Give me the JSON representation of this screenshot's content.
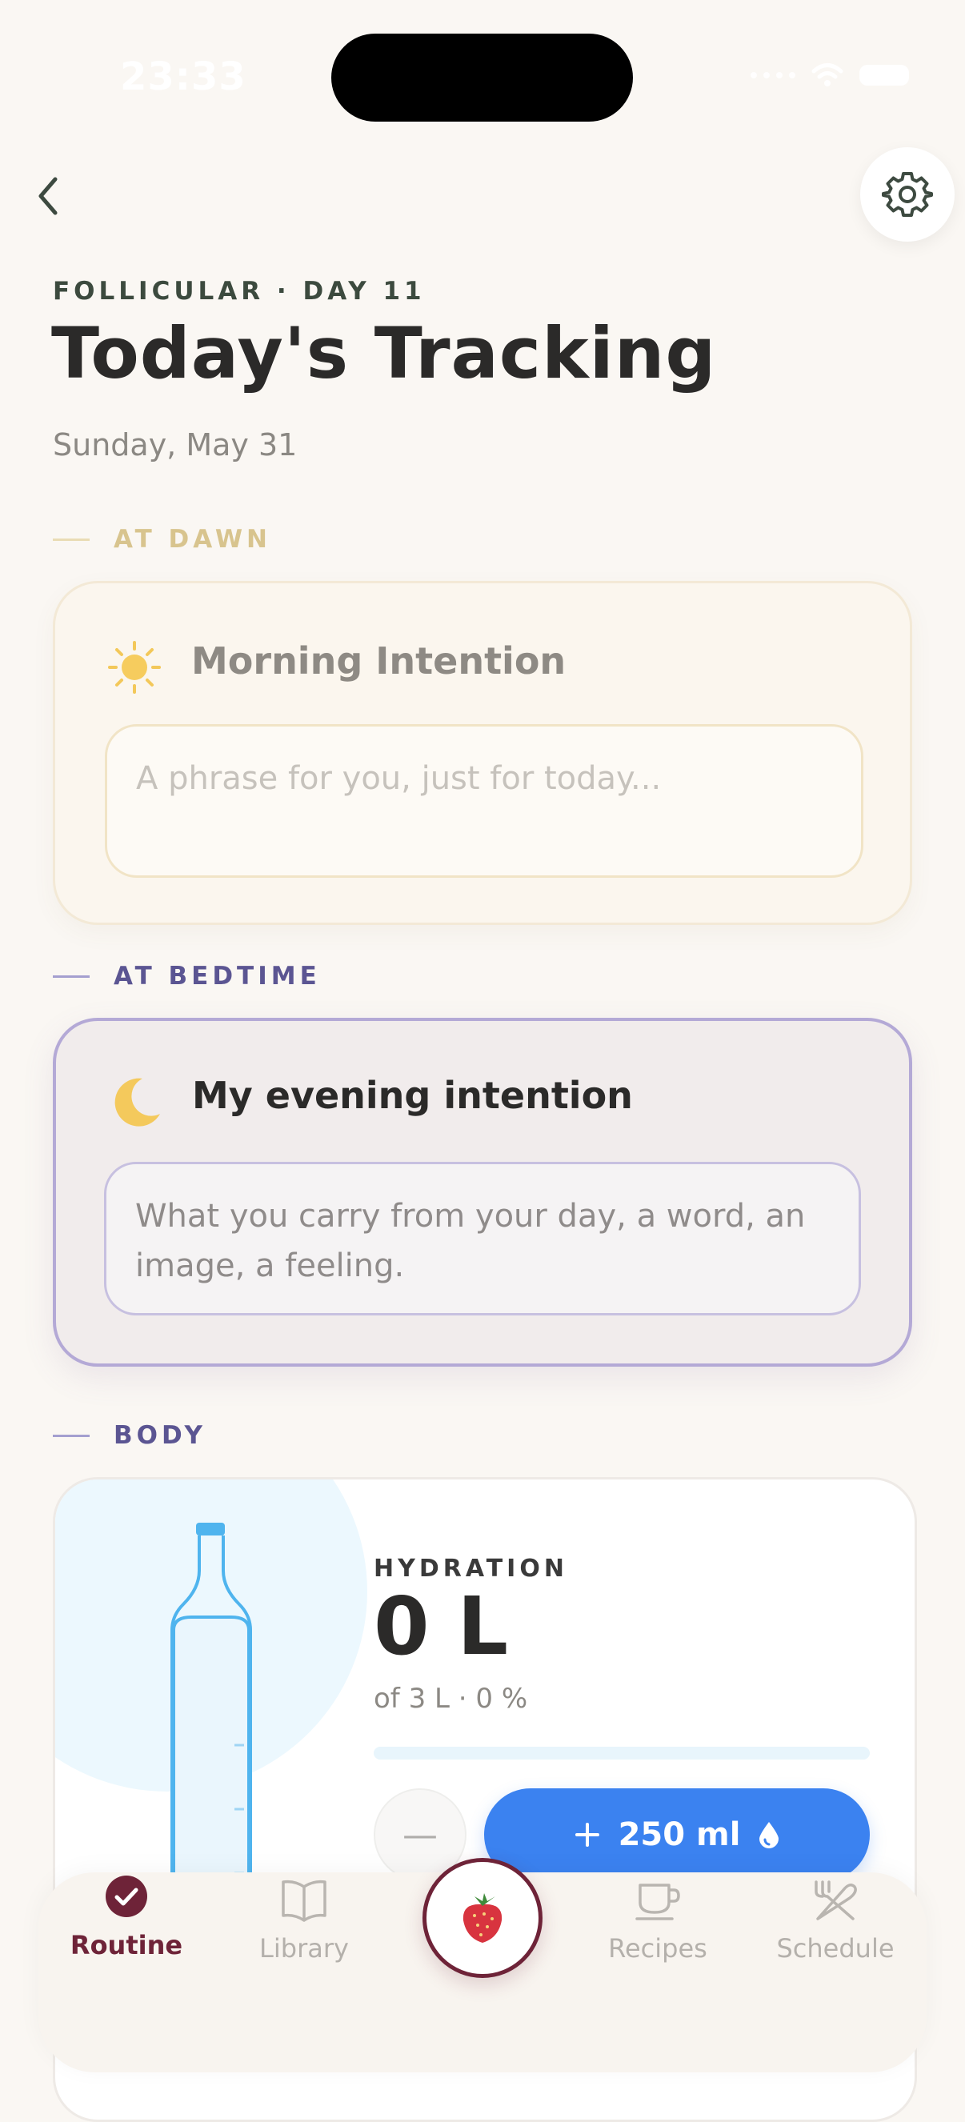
{
  "status_bar": {
    "time": "23:33"
  },
  "header": {
    "phase": "FOLLICULAR · DAY 11",
    "title": "Today's Tracking",
    "date": "Sunday, May 31"
  },
  "sections": {
    "dawn": "AT DAWN",
    "bedtime": "AT BEDTIME",
    "body": "BODY"
  },
  "morning_card": {
    "icon": "sun-icon",
    "title": "Morning Intention",
    "placeholder": "A phrase for you, just for today..."
  },
  "evening_card": {
    "icon": "moon-icon",
    "title": "My evening intention",
    "placeholder": "What you carry from your day, a word, an image, a feeling."
  },
  "hydration": {
    "label": "HYDRATION",
    "value": "0 L",
    "goal": "of 3 L · 0 %",
    "progress": 0,
    "add_label": "250 ml"
  },
  "nav": {
    "items": [
      {
        "label": "Routine",
        "icon": "check-circle-icon",
        "active": true
      },
      {
        "label": "Library",
        "icon": "book-icon",
        "active": false
      },
      {
        "label": "",
        "icon": "strawberry-icon",
        "active": false
      },
      {
        "label": "Recipes",
        "icon": "cup-icon",
        "active": false
      },
      {
        "label": "Schedule",
        "icon": "utensils-icon",
        "active": false
      }
    ]
  },
  "colors": {
    "background": "#faf7f3",
    "accent_blue": "#3b82f0",
    "dawn_gold": "#d8c48e",
    "bedtime_purple": "#5b5592",
    "brand_wine": "#6e2338"
  }
}
